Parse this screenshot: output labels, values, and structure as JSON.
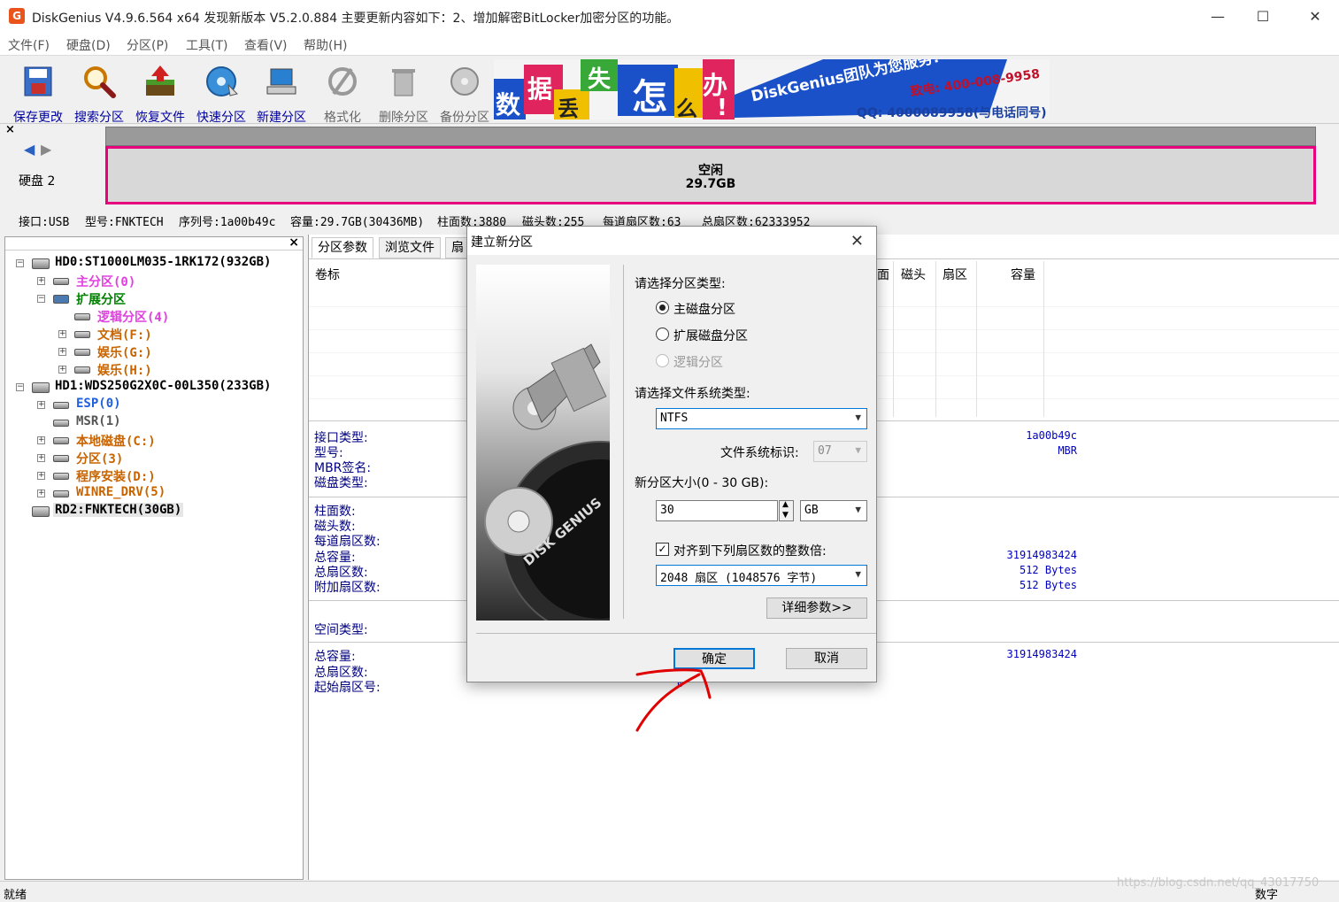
{
  "window": {
    "title": "DiskGenius V4.9.6.564 x64    发现新版本 V5.2.0.884 主要更新内容如下：2、增加解密BitLocker加密分区的功能。",
    "minimize": "—",
    "maximize": "☐",
    "close": "✕"
  },
  "menu": [
    "文件(F)",
    "硬盘(D)",
    "分区(P)",
    "工具(T)",
    "查看(V)",
    "帮助(H)"
  ],
  "toolbar": [
    {
      "label": "保存更改",
      "icon": "save-icon"
    },
    {
      "label": "搜索分区",
      "icon": "search-icon"
    },
    {
      "label": "恢复文件",
      "icon": "recover-icon"
    },
    {
      "label": "快速分区",
      "icon": "quick-partition-icon"
    },
    {
      "label": "新建分区",
      "icon": "new-partition-icon"
    },
    {
      "label": "格式化",
      "icon": "format-icon"
    },
    {
      "label": "删除分区",
      "icon": "delete-icon"
    },
    {
      "label": "备份分区",
      "icon": "backup-icon"
    }
  ],
  "banner": {
    "chars": [
      "数",
      "据",
      "丢",
      "失",
      "怎",
      "么",
      "办",
      "!"
    ],
    "slogan": "DiskGenius团队为您服务!",
    "phone": "致电: 400-008-9958",
    "qq": "QQ: 4000089958(与电话同号)"
  },
  "diskmap": {
    "close": "×",
    "disk_label": "硬盘 2",
    "free_label": "空闲",
    "free_size": "29.7GB"
  },
  "diskinfo": {
    "interface": "接口:USB",
    "model": "型号:FNKTECH",
    "serial": "序列号:1a00b49c",
    "capacity": "容量:29.7GB(30436MB)",
    "cylinders": "柱面数:3880",
    "heads": "磁头数:255",
    "sectors_per_track": "每道扇区数:63",
    "total_sectors": "总扇区数:62333952"
  },
  "tree": {
    "close": "×",
    "nodes": [
      {
        "label": "HD0:ST1000LM035-1RK172(932GB)",
        "color": "#000000"
      },
      {
        "label": "主分区(0)",
        "color": "#e040e0"
      },
      {
        "label": "扩展分区",
        "color": "#008000"
      },
      {
        "label": "逻辑分区(4)",
        "color": "#e040e0"
      },
      {
        "label": "文档(F:)",
        "color": "#c86400"
      },
      {
        "label": "娱乐(G:)",
        "color": "#c86400"
      },
      {
        "label": "娱乐(H:)",
        "color": "#c86400"
      },
      {
        "label": "HD1:WDS250G2X0C-00L350(233GB)",
        "color": "#000000"
      },
      {
        "label": "ESP(0)",
        "color": "#2060e0"
      },
      {
        "label": "MSR(1)",
        "color": "#555555"
      },
      {
        "label": "本地磁盘(C:)",
        "color": "#c86400"
      },
      {
        "label": "分区(3)",
        "color": "#c86400"
      },
      {
        "label": "程序安装(D:)",
        "color": "#c86400"
      },
      {
        "label": "WINRE_DRV(5)",
        "color": "#c86400"
      },
      {
        "label": "RD2:FNKTECH(30GB)",
        "color": "#000000"
      }
    ]
  },
  "right": {
    "tabs": [
      "分区参数",
      "浏览文件",
      "扇"
    ],
    "columns": {
      "volume": "卷标",
      "face": "面",
      "head": "磁头",
      "sector": "扇区",
      "capacity": "容量"
    },
    "labels": {
      "iface_type": "接口类型:",
      "model": "型号:",
      "mbr_sig": "MBR签名:",
      "disk_type": "磁盘类型:",
      "cylinders": "柱面数:",
      "heads": "磁头数:",
      "spt": "每道扇区数:",
      "total_cap": "总容量:",
      "total_sec": "总扇区数:",
      "extra_sec": "附加扇区数:",
      "space_type": "空间类型:",
      "total_cap2": "总容量:",
      "total_sec2": "总扇区数:",
      "start_sec": "起始扇区号:"
    },
    "values": {
      "serial": "1a00b49c",
      "mbr": "MBR",
      "total_bytes": "31914983424",
      "sector_size1": "512 Bytes",
      "sector_size2": "512 Bytes",
      "total_bytes2": "31914983424"
    },
    "hidden_zero": "0"
  },
  "status": {
    "left": "就绪",
    "right": "数字",
    "watermark": "https://blog.csdn.net/qq_43017750"
  },
  "dialog": {
    "title": "建立新分区",
    "close": "✕",
    "image_text": "DISK GENIUS",
    "type_prompt": "请选择分区类型:",
    "types": [
      {
        "label": "主磁盘分区",
        "checked": true,
        "disabled": false
      },
      {
        "label": "扩展磁盘分区",
        "checked": false,
        "disabled": false
      },
      {
        "label": "逻辑分区",
        "checked": false,
        "disabled": true
      }
    ],
    "fs_prompt": "请选择文件系统类型:",
    "fs_value": "NTFS",
    "fs_id_label": "文件系统标识:",
    "fs_id_value": "07",
    "size_label": "新分区大小(0 - 30 GB):",
    "size_value": "30",
    "size_unit": "GB",
    "align_label": "对齐到下列扇区数的整数倍:",
    "align_checked": true,
    "align_value": "2048 扇区 (1048576 字节)",
    "detail_button": "详细参数>>",
    "ok_button": "确定",
    "cancel_button": "取消"
  },
  "colors": {
    "accent": "#0078d7",
    "diskmap_border": "#e6007e",
    "annotation": "#e00000"
  }
}
